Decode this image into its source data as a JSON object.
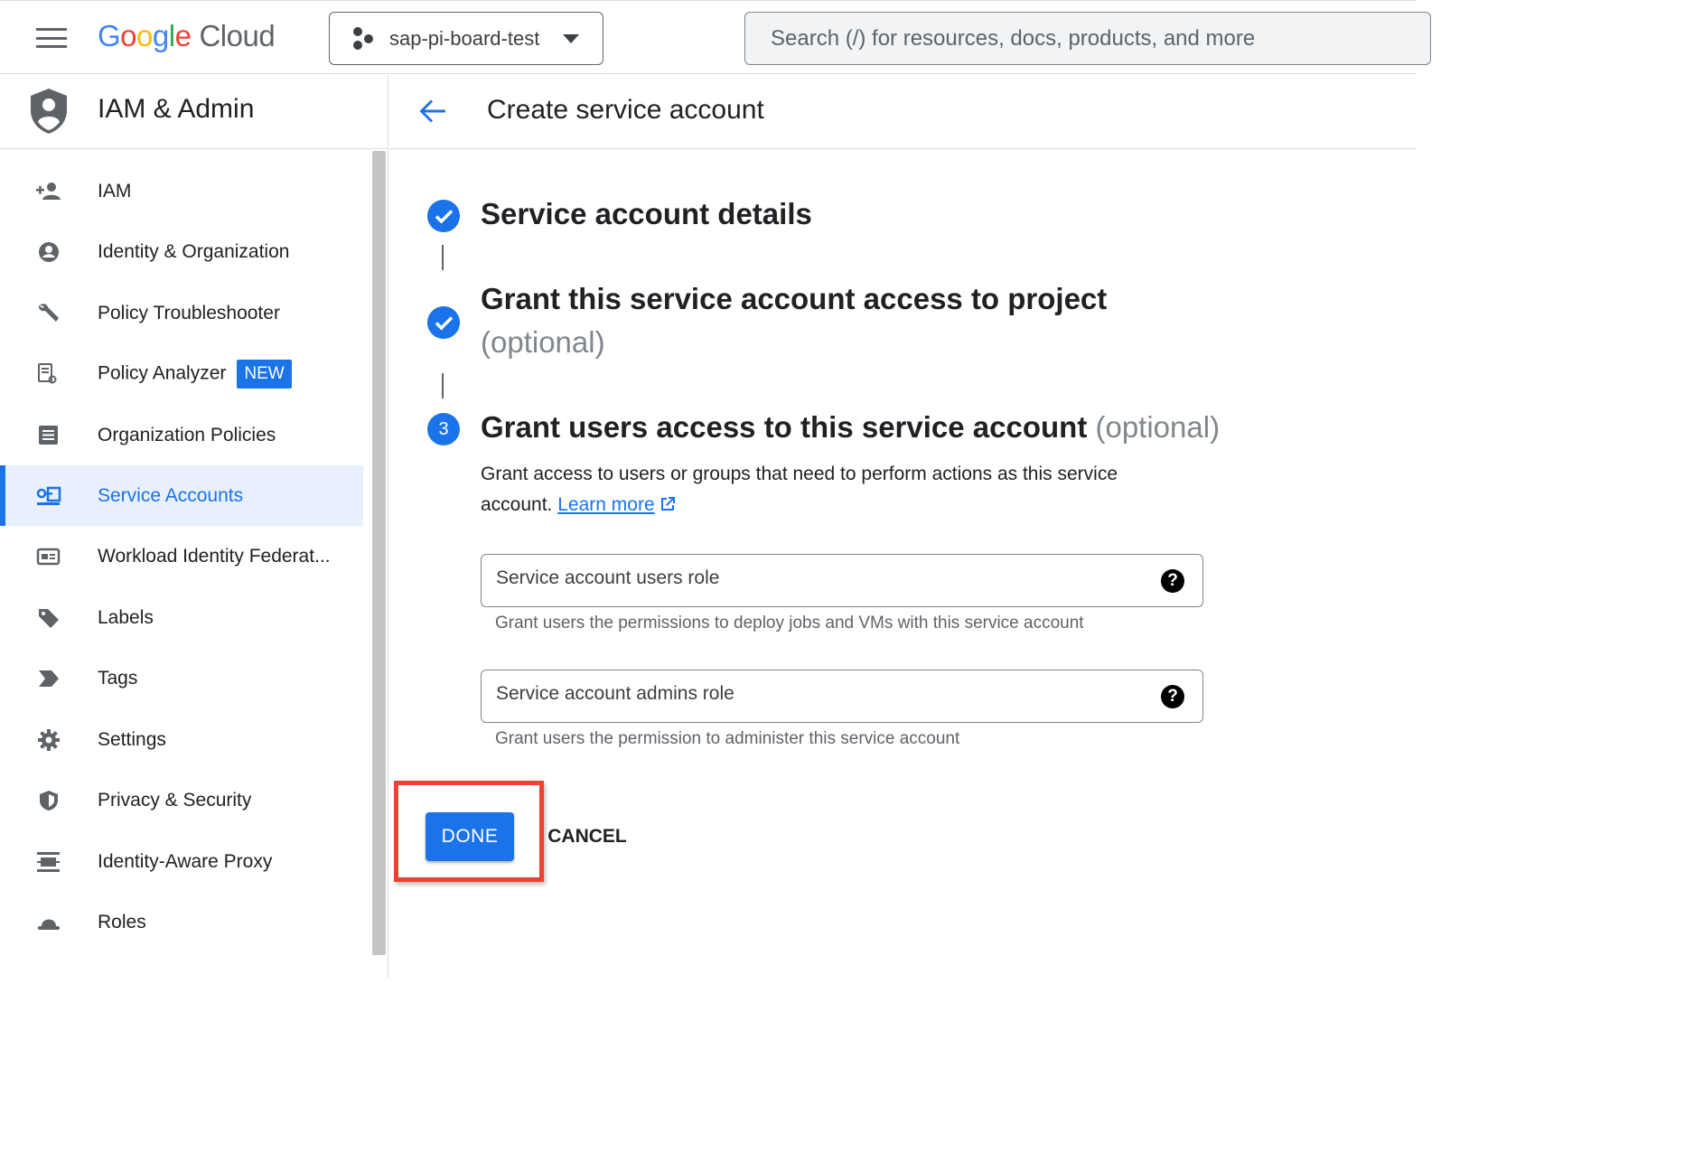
{
  "topbar": {
    "logo_google": [
      "G",
      "o",
      "o",
      "g",
      "l",
      "e"
    ],
    "logo_cloud": "Cloud",
    "project_name": "sap-pi-board-test",
    "search_placeholder": "Search (/) for resources, docs, products, and more"
  },
  "sidebar": {
    "title": "IAM & Admin",
    "items": [
      {
        "label": "IAM",
        "icon": "person-add-icon"
      },
      {
        "label": "Identity & Organization",
        "icon": "account-circle-icon"
      },
      {
        "label": "Policy Troubleshooter",
        "icon": "wrench-icon"
      },
      {
        "label": "Policy Analyzer",
        "icon": "document-search-icon",
        "badge": "NEW"
      },
      {
        "label": "Organization Policies",
        "icon": "list-document-icon"
      },
      {
        "label": "Service Accounts",
        "icon": "service-account-icon",
        "active": true
      },
      {
        "label": "Workload Identity Federat...",
        "icon": "id-card-icon"
      },
      {
        "label": "Labels",
        "icon": "label-tag-icon"
      },
      {
        "label": "Tags",
        "icon": "tag-arrow-icon"
      },
      {
        "label": "Settings",
        "icon": "gear-icon"
      },
      {
        "label": "Privacy & Security",
        "icon": "shield-icon"
      },
      {
        "label": "Identity-Aware Proxy",
        "icon": "proxy-icon"
      },
      {
        "label": "Roles",
        "icon": "hat-icon"
      }
    ]
  },
  "main": {
    "page_title": "Create service account",
    "steps": [
      {
        "title": "Service account details",
        "state": "complete"
      },
      {
        "title": "Grant this service account access to project",
        "optional": "(optional)",
        "state": "complete"
      },
      {
        "number": "3",
        "title": "Grant users access to this service account",
        "optional": "(optional)",
        "state": "active"
      }
    ],
    "description": "Grant access to users or groups that need to perform actions as this service account.",
    "learn_more": "Learn more",
    "fields": [
      {
        "placeholder": "Service account users role",
        "hint": "Grant users the permissions to deploy jobs and VMs with this service account"
      },
      {
        "placeholder": "Service account admins role",
        "hint": "Grant users the permission to administer this service account"
      }
    ],
    "help_glyph": "?",
    "done_label": "DONE",
    "cancel_label": "CANCEL"
  },
  "colors": {
    "accent": "#1a73e8",
    "highlight": "#ea4335",
    "active_bg": "#e8f0fe"
  }
}
